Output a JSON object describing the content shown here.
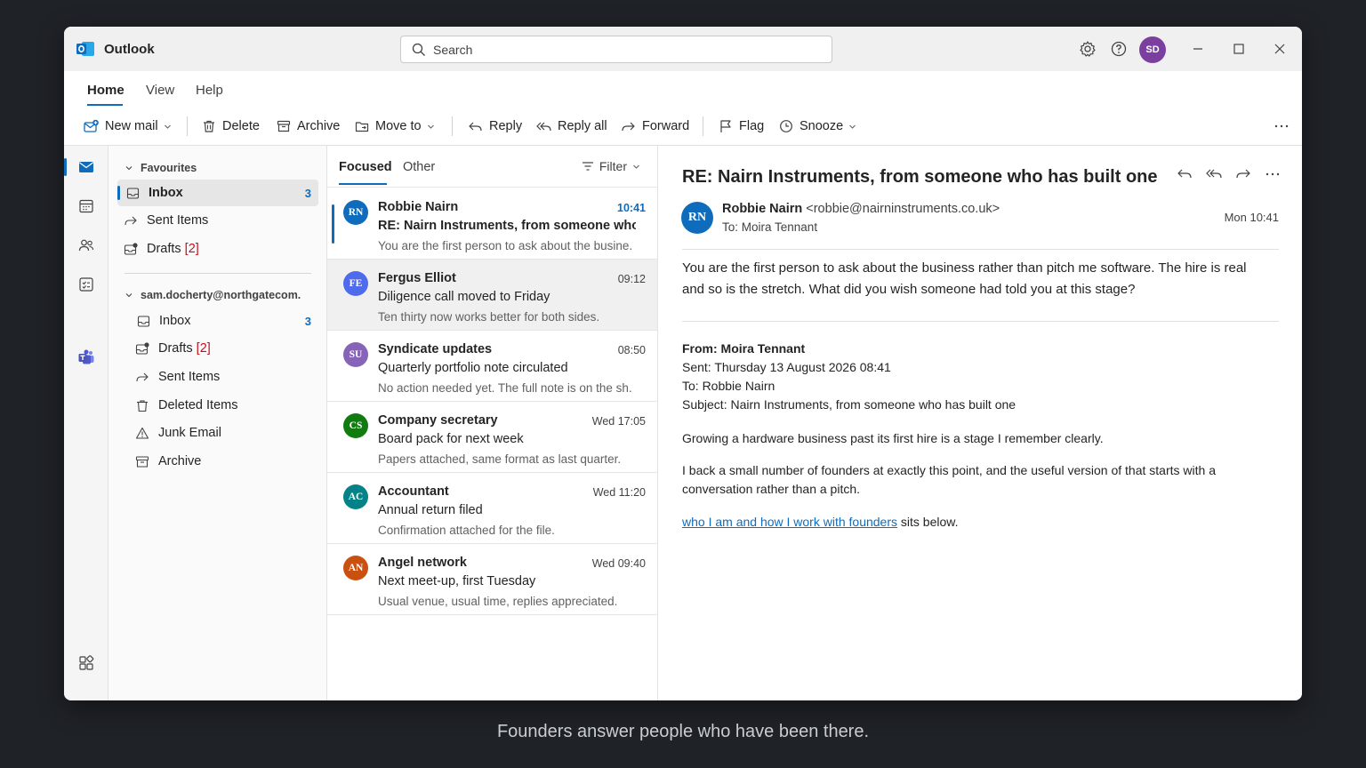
{
  "app": {
    "title": "Outlook",
    "brand_color": "#0f6cbd"
  },
  "search": {
    "placeholder": "Search"
  },
  "user": {
    "initials": "SD",
    "avatar_color": "#7b3fa0"
  },
  "ribbon": {
    "tabs": [
      "Home",
      "View",
      "Help"
    ],
    "active_tab": "Home"
  },
  "toolbar": {
    "new_mail": "New mail",
    "delete": "Delete",
    "archive": "Archive",
    "move_to": "Move to",
    "reply": "Reply",
    "reply_all": "Reply all",
    "forward": "Forward",
    "flag": "Flag",
    "snooze": "Snooze"
  },
  "favourites": {
    "heading": "Favourites",
    "items": [
      {
        "label": "Inbox",
        "count": "3",
        "icon": "inbox-icon",
        "selected": true
      },
      {
        "label": "Sent Items",
        "icon": "sent-icon"
      },
      {
        "label": "Drafts",
        "draft_count": "[2]",
        "icon": "drafts-icon"
      }
    ]
  },
  "account": {
    "email": "sam.docherty@northgatecom.",
    "items": [
      {
        "label": "Inbox",
        "count": "3",
        "icon": "inbox-icon"
      },
      {
        "label": "Drafts",
        "draft_count": "[2]",
        "icon": "drafts-icon"
      },
      {
        "label": "Sent Items",
        "icon": "sent-icon"
      },
      {
        "label": "Deleted Items",
        "icon": "trash-icon"
      },
      {
        "label": "Junk Email",
        "icon": "junk-icon"
      },
      {
        "label": "Archive",
        "icon": "archive-icon"
      }
    ]
  },
  "message_list": {
    "tabs": [
      "Focused",
      "Other"
    ],
    "active_tab": "Focused",
    "filter_label": "Filter",
    "messages": [
      {
        "initials": "RN",
        "color": "#0f6cbd",
        "sender": "Robbie Nairn",
        "time": "10:41",
        "subject": "RE: Nairn Instruments, from someone who .",
        "preview": "You are the first person to ask about the busine.",
        "unread": true
      },
      {
        "initials": "FE",
        "color": "#4f6bed",
        "sender": "Fergus Elliot",
        "time": "09:12",
        "subject": "Diligence call moved to Friday",
        "preview": "Ten thirty now works better for both sides.",
        "unread": false
      },
      {
        "initials": "SU",
        "color": "#8764b8",
        "sender": "Syndicate updates",
        "time": "08:50",
        "subject": "Quarterly portfolio note circulated",
        "preview": "No action needed yet. The full note is on the sh.",
        "unread": false
      },
      {
        "initials": "CS",
        "color": "#107c10",
        "sender": "Company secretary",
        "time": "Wed 17:05",
        "subject": "Board pack for next week",
        "preview": "Papers attached, same format as last quarter.",
        "unread": false
      },
      {
        "initials": "AC",
        "color": "#038387",
        "sender": "Accountant",
        "time": "Wed 11:20",
        "subject": "Annual return filed",
        "preview": "Confirmation attached for the file.",
        "unread": false
      },
      {
        "initials": "AN",
        "color": "#ca5010",
        "sender": "Angel network",
        "time": "Wed 09:40",
        "subject": "Next meet-up, first Tuesday",
        "preview": "Usual venue, usual time, replies appreciated.",
        "unread": false
      }
    ]
  },
  "reading": {
    "subject": "RE: Nairn Instruments, from someone who has built one",
    "sender_initials": "RN",
    "sender_name": "Robbie Nairn",
    "sender_email": "<robbie@nairninstruments.co.uk>",
    "to": "To: Moira Tennant",
    "date": "Mon 10:41",
    "body": "You are the first person to ask about the business rather than pitch me software. The hire is real and so is the stretch. What did you wish someone had told you at this stage?",
    "quoted": {
      "from": "From: Moira Tennant",
      "sent": "Sent: Thursday 13 August 2026 08:41",
      "to": "To: Robbie Nairn",
      "subject": "Subject: Nairn Instruments, from someone who has built one",
      "para1": "Growing a hardware business past its first hire is a stage I remember clearly.",
      "para2": "I back a small number of founders at exactly this point, and the useful version of that starts with a conversation rather than a pitch.",
      "link_text": "who I am and how I work with founders",
      "after_link": " sits below."
    }
  },
  "caption": "Founders answer people who have been there."
}
